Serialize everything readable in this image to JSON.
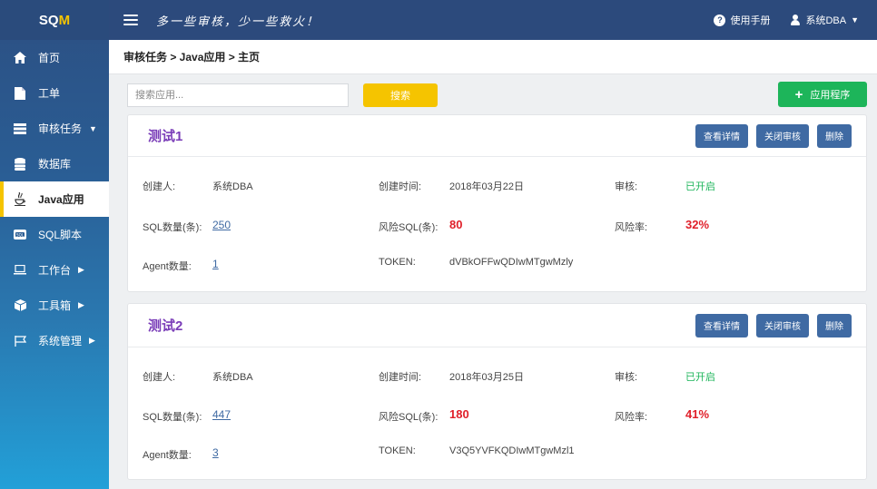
{
  "brand": {
    "prefix": "SQ",
    "highlight": "M"
  },
  "header": {
    "slogan": "多一些审核，少一些救火！",
    "help_label": "使用手册",
    "user_label": "系统DBA"
  },
  "sidebar": {
    "items": [
      {
        "label": "首页",
        "icon": "home-icon",
        "has_caret": false
      },
      {
        "label": "工单",
        "icon": "document-icon",
        "has_caret": false
      },
      {
        "label": "审核任务",
        "icon": "list-icon",
        "has_caret": true,
        "caret": "▼"
      },
      {
        "label": "数据库",
        "icon": "database-icon",
        "has_caret": false
      },
      {
        "label": "Java应用",
        "icon": "java-icon",
        "has_caret": false,
        "active": true
      },
      {
        "label": "SQL脚本",
        "icon": "sql-script-icon",
        "has_caret": false
      },
      {
        "label": "工作台",
        "icon": "laptop-icon",
        "has_caret": true,
        "caret": "▶"
      },
      {
        "label": "工具箱",
        "icon": "toolbox-icon",
        "has_caret": true,
        "caret": "▶"
      },
      {
        "label": "系统管理",
        "icon": "flag-icon",
        "has_caret": true,
        "caret": "▶"
      }
    ]
  },
  "breadcrumb": "审核任务 > Java应用 > 主页",
  "toolbar": {
    "search_placeholder": "搜索应用...",
    "search_label": "搜索",
    "add_label": "应用程序"
  },
  "colors": {
    "accent": "#f5c400",
    "primary": "#3f6aa3",
    "success": "#1db55a",
    "danger": "#e0202a",
    "title": "#7a3db8"
  },
  "card_actions": {
    "detail": "查看详情",
    "close": "关闭审核",
    "delete": "删除"
  },
  "field_labels": {
    "creator": "创建人:",
    "created_at": "创建时间:",
    "audit": "审核:",
    "sql_count": "SQL数量(条):",
    "risk_sql": "风险SQL(条):",
    "risk_rate": "风险率:",
    "agent_count": "Agent数量:",
    "token": "TOKEN:"
  },
  "apps": [
    {
      "name": "测试1",
      "creator": "系统DBA",
      "created_at": "2018年03月22日",
      "audit": "已开启",
      "sql_count": "250",
      "risk_sql": "80",
      "risk_rate": "32%",
      "agent_count": "1",
      "token": "dVBkOFFwQDIwMTgwMzly"
    },
    {
      "name": "测试2",
      "creator": "系统DBA",
      "created_at": "2018年03月25日",
      "audit": "已开启",
      "sql_count": "447",
      "risk_sql": "180",
      "risk_rate": "41%",
      "agent_count": "3",
      "token": "V3Q5YVFKQDIwMTgwMzl1"
    }
  ]
}
